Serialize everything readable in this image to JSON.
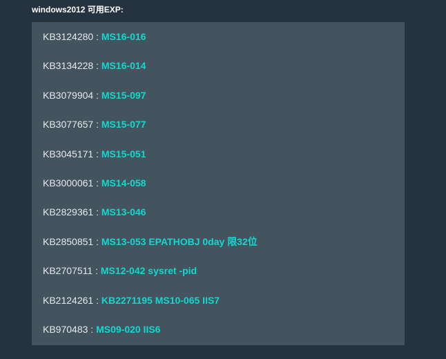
{
  "heading": "windows2012 可用EXP:",
  "separator": " : ",
  "entries": [
    {
      "kb": "KB3124280",
      "exp": "MS16-016"
    },
    {
      "kb": "KB3134228",
      "exp": "MS16-014"
    },
    {
      "kb": "KB3079904",
      "exp": "MS15-097"
    },
    {
      "kb": "KB3077657",
      "exp": "MS15-077"
    },
    {
      "kb": "KB3045171",
      "exp": "MS15-051"
    },
    {
      "kb": "KB3000061",
      "exp": "MS14-058"
    },
    {
      "kb": "KB2829361",
      "exp": "MS13-046"
    },
    {
      "kb": "KB2850851",
      "exp": "MS13-053 EPATHOBJ 0day 限32位"
    },
    {
      "kb": "KB2707511",
      "exp": "MS12-042 sysret -pid"
    },
    {
      "kb": "KB2124261",
      "exp": "KB2271195 MS10-065 IIS7"
    },
    {
      "kb": "KB970483",
      "exp": "MS09-020 IIS6"
    }
  ],
  "colors": {
    "background": "#253340",
    "panel": "#44545f",
    "kb_text": "#e6e9ec",
    "exp_text": "#11d9cf"
  }
}
